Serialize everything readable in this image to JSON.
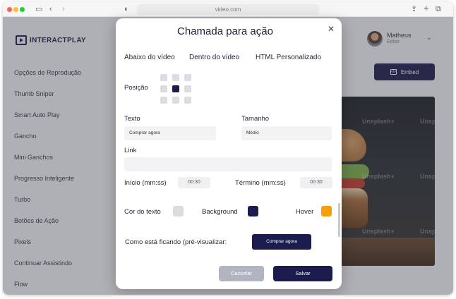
{
  "browser": {
    "url": "video.com",
    "icons": [
      "sidebar-toggle-icon",
      "back-icon",
      "forward-icon",
      "privacy-icon",
      "share-icon",
      "new-tab-icon",
      "tabs-icon"
    ]
  },
  "app": {
    "logo_text": "INTERACTPLAY",
    "user": {
      "name": "Matheus",
      "subtitle": "Editar"
    },
    "embed_label": "Embed",
    "sidebar": {
      "items": [
        {
          "label": "Opções de Reprodução"
        },
        {
          "label": "Thumb Sniper"
        },
        {
          "label": "Smart Auto Play"
        },
        {
          "label": "Gancho"
        },
        {
          "label": "Mini Ganchos"
        },
        {
          "label": "Progresso Inteligente"
        },
        {
          "label": "Turbo"
        },
        {
          "label": "Botões de Ação"
        },
        {
          "label": "Pixels"
        },
        {
          "label": "Continuar Assistindo"
        },
        {
          "label": "Flow"
        }
      ]
    },
    "video": {
      "watermark": "Unsplash+"
    }
  },
  "modal": {
    "title": "Chamada para ação",
    "tabs": [
      {
        "label": "Abaixo do vídeo",
        "active": false
      },
      {
        "label": "Dentro do vídeo",
        "active": true
      },
      {
        "label": "HTML Personalizado",
        "active": false
      }
    ],
    "position_label": "Posição",
    "position_selected": "center",
    "text_label": "Texto",
    "text_value": "Comprar agora",
    "size_label": "Tamanho",
    "size_value": "Médio",
    "link_label": "Link",
    "link_value": "",
    "start_label": "Início (mm:ss)",
    "start_value": "00:30",
    "end_label": "Término (mm:ss)",
    "end_value": "00:30",
    "color_text_label": "Cor do texto",
    "color_text": "#dcdcdc",
    "background_label": "Background",
    "background_color": "#1b1b4d",
    "hover_label": "Hover",
    "hover_color": "#f5a00b",
    "preview_label": "Como está ficando (pré-visualizar:",
    "preview_button": "Comprar agora",
    "cancel_label": "Cancelar",
    "save_label": "Salvar"
  }
}
